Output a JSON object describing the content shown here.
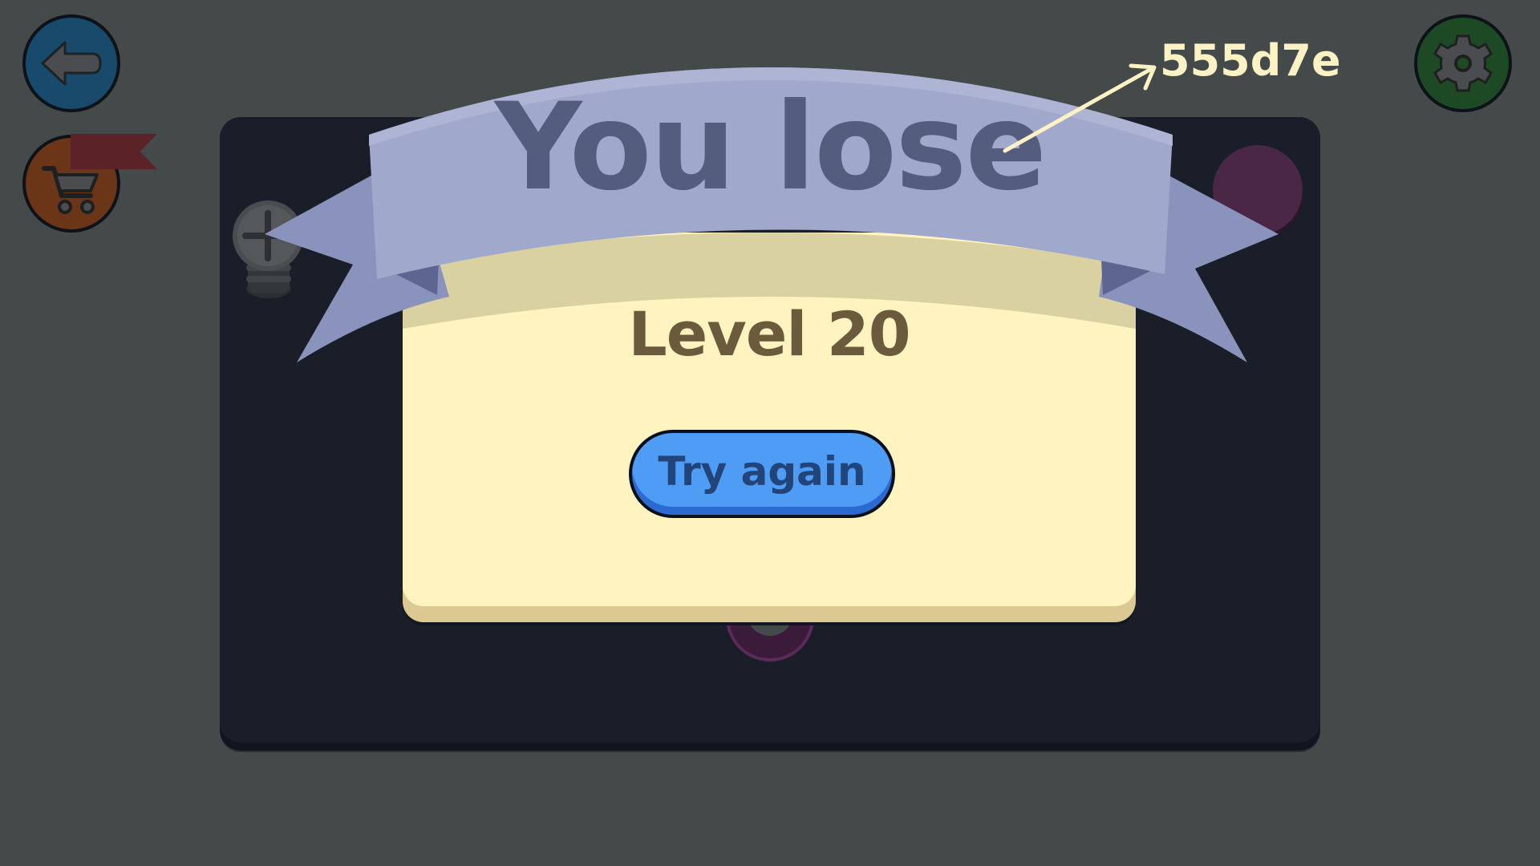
{
  "banner": {
    "title": "You lose"
  },
  "panel": {
    "level_label": "Level 20",
    "retry_label": "Try again"
  },
  "annotation": {
    "color_code": "555d7e"
  },
  "toolbar": {
    "back_icon": "back-arrow-icon",
    "shop_icon": "shopping-cart-icon",
    "settings_icon": "gear-icon"
  },
  "colors": {
    "background": "#434a49",
    "board": "#191e29",
    "banner": "#a0a8cc",
    "banner_text": "#555d7e",
    "panel": "#fff3c0",
    "button": "#4f9cf5",
    "back_button": "#184a6b",
    "shop_button": "#6b3518",
    "settings_button": "#1d4a25"
  }
}
